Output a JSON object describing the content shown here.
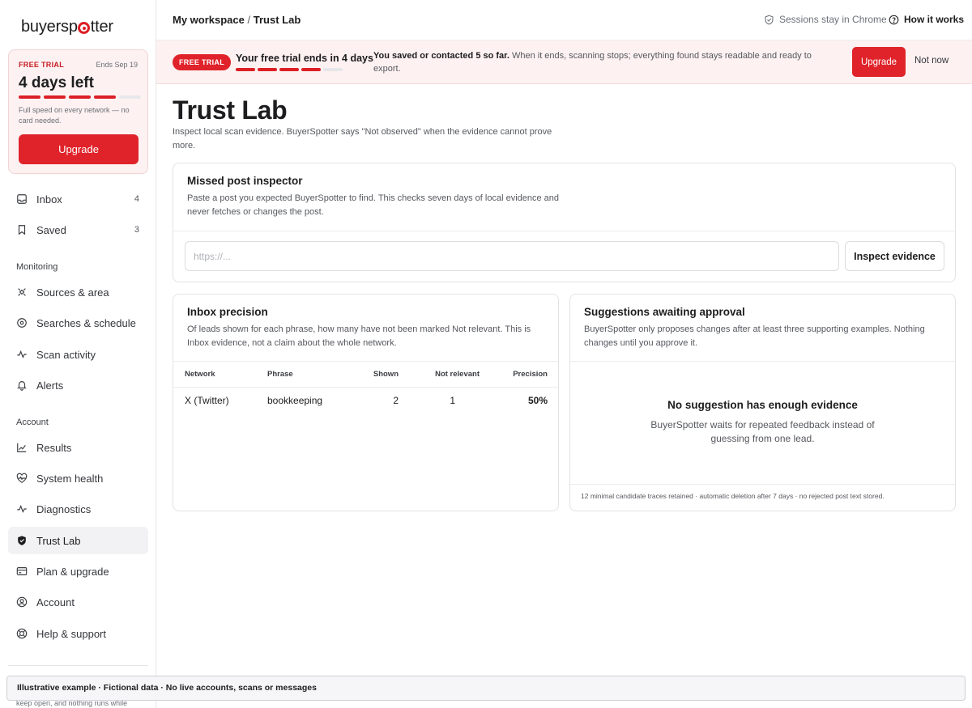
{
  "brand": {
    "logo_pre": "buyersp",
    "logo_post": "tter"
  },
  "sidebar": {
    "trial": {
      "tag": "FREE TRIAL",
      "ends": "Ends Sep 19",
      "days_left": "4 days left",
      "progress_filled": 4,
      "progress_total": 5,
      "description": "Full speed on every network — no card needed.",
      "upgrade_label": "Upgrade"
    },
    "top_items": [
      {
        "label": "Inbox",
        "count": "4",
        "icon": "inbox-icon"
      },
      {
        "label": "Saved",
        "count": "3",
        "icon": "bookmark-icon"
      }
    ],
    "monitoring_label": "Monitoring",
    "monitoring_items": [
      {
        "label": "Sources & area",
        "icon": "satellite-icon"
      },
      {
        "label": "Searches & schedule",
        "icon": "target-icon"
      },
      {
        "label": "Scan activity",
        "icon": "activity-icon"
      },
      {
        "label": "Alerts",
        "icon": "bell-icon"
      }
    ],
    "account_label": "Account",
    "account_items": [
      {
        "label": "Results",
        "icon": "chart-line-icon"
      },
      {
        "label": "System health",
        "icon": "heart-pulse-icon"
      },
      {
        "label": "Diagnostics",
        "icon": "pulse-icon"
      },
      {
        "label": "Trust Lab",
        "icon": "shield-icon",
        "active": true
      },
      {
        "label": "Plan & upgrade",
        "icon": "credit-card-icon"
      },
      {
        "label": "Account",
        "icon": "user-circle-icon"
      },
      {
        "label": "Help & support",
        "icon": "lifebuoy-icon"
      }
    ],
    "footnote": "keep open, and nothing runs while"
  },
  "header": {
    "workspace": "My workspace",
    "separator": "/",
    "current": "Trust Lab",
    "sessions": "Sessions stay in Chrome",
    "how_it_works": "How it works"
  },
  "banner": {
    "pill": "FREE TRIAL",
    "ends_text": "Your free trial ends in 4 days",
    "progress_filled": 4,
    "progress_total": 5,
    "message_bold": "You saved or contacted 5 so far.",
    "message_rest": " When it ends, scanning stops; everything found stays readable and ready to export.",
    "upgrade_label": "Upgrade",
    "not_now_label": "Not now"
  },
  "page": {
    "title": "Trust Lab",
    "subtitle": "Inspect local scan evidence. BuyerSpotter says \"Not observed\" when the evidence cannot prove more."
  },
  "inspector": {
    "title": "Missed post inspector",
    "description": "Paste a post you expected BuyerSpotter to find. This checks seven days of local evidence and never fetches or changes the post.",
    "placeholder": "https://...",
    "button_label": "Inspect evidence"
  },
  "precision": {
    "title": "Inbox precision",
    "description": "Of leads shown for each phrase, how many have not been marked Not relevant. This is Inbox evidence, not a claim about the whole network.",
    "columns": {
      "network": "Network",
      "phrase": "Phrase",
      "shown": "Shown",
      "not_relevant": "Not relevant",
      "precision": "Precision"
    },
    "rows": [
      {
        "network": "X (Twitter)",
        "phrase": "bookkeeping",
        "shown": "2",
        "not_relevant": "1",
        "precision": "50%"
      }
    ]
  },
  "suggestions": {
    "title": "Suggestions awaiting approval",
    "description": "BuyerSpotter only proposes changes after at least three supporting examples. Nothing changes until you approve it.",
    "empty_title": "No suggestion has enough evidence",
    "empty_desc": "BuyerSpotter waits for repeated feedback instead of guessing from one lead.",
    "retention": "12 minimal candidate traces retained · automatic deletion after 7 days · no rejected post text stored."
  },
  "demo_strip": "Illustrative example · Fictional data · No live accounts, scans or messages",
  "colors": {
    "accent": "#e0232a",
    "banner_bg": "#fdf1f1"
  }
}
